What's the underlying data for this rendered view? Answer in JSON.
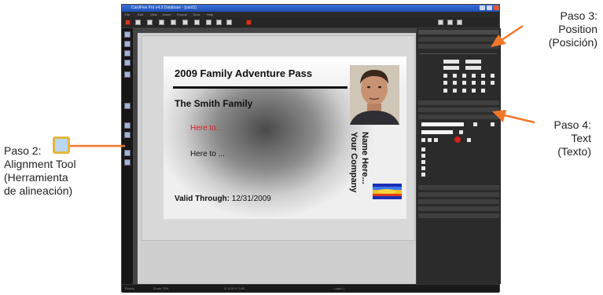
{
  "app": {
    "title": "CardFive Pro v4.3 Database - [card1]",
    "menu": [
      "File",
      "Edit",
      "View",
      "Insert",
      "Format",
      "Tools",
      "Help"
    ],
    "status": [
      "Ready",
      "Zoom 75%",
      "X: 0.00 Y: 0.00",
      "Layer 1"
    ]
  },
  "card": {
    "title": "2009 Family Adventure Pass",
    "family": "The Smith Family",
    "here_red": "Here to...",
    "here_black": "Here to ...",
    "valid_label": "Valid Through:",
    "valid_date": "12/31/2009",
    "company_line1": "Your Company",
    "company_line2": "Name Here..."
  },
  "callouts": {
    "step2": {
      "line1": "Paso 2:",
      "line2": "Alignment Tool",
      "line3": "(Herramienta",
      "line4": "de alineación)"
    },
    "step3": {
      "line1": "Paso 3:",
      "line2": "Position",
      "line3": "(Posición)"
    },
    "step4": {
      "line1": "Paso 4:",
      "line2": "Text",
      "line3": "(Texto)"
    }
  },
  "colors": {
    "arrow": "#f2772a",
    "title_bar": "#2a5fd0",
    "accent_red": "#d81e1e",
    "icon_border": "#e2b53c"
  }
}
